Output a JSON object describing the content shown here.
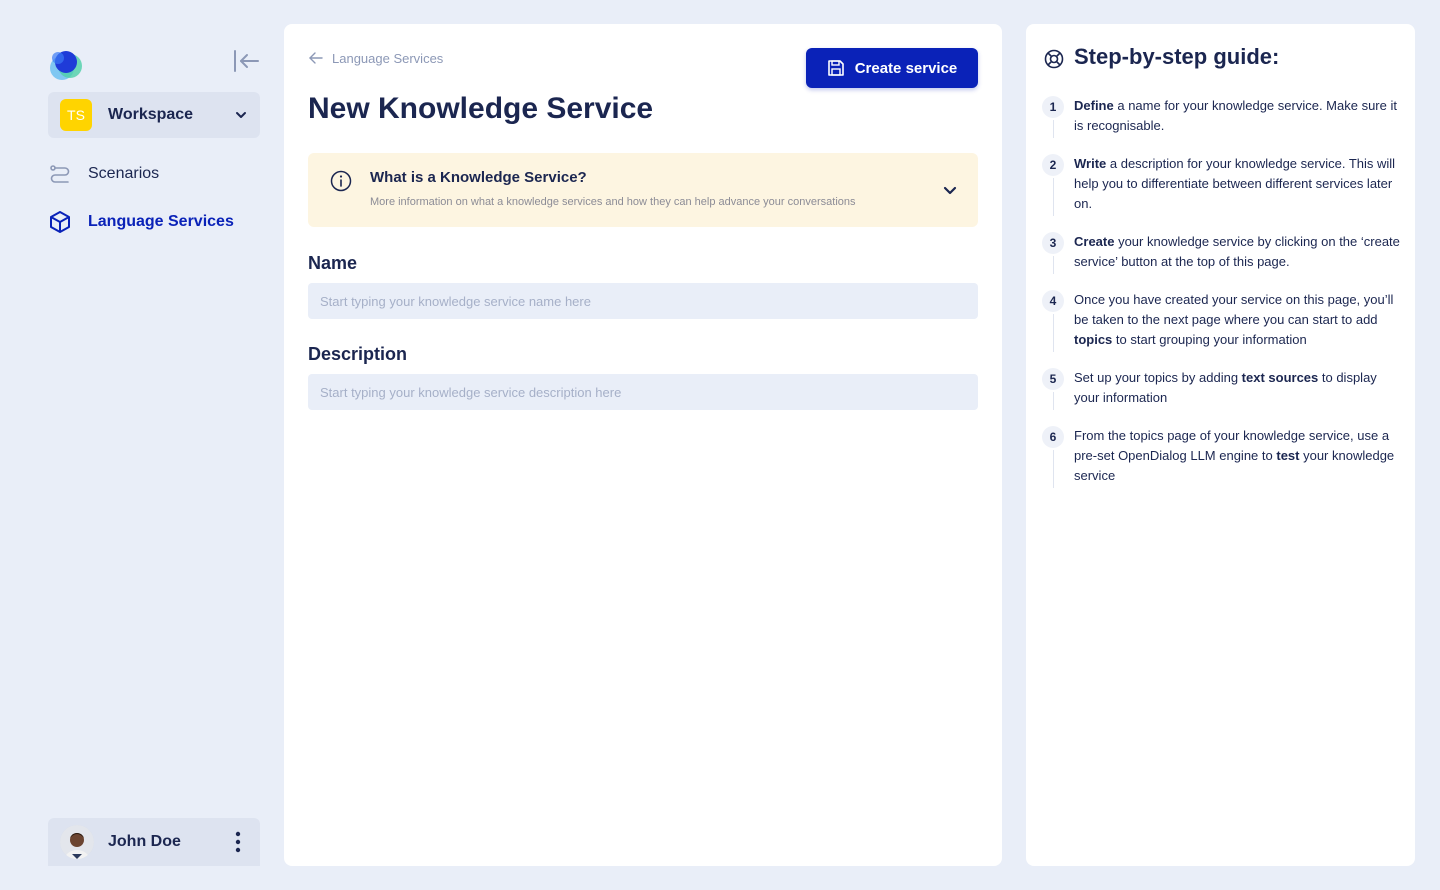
{
  "sidebar": {
    "workspace": {
      "initials": "TS",
      "label": "Workspace"
    },
    "nav": [
      {
        "label": "Scenarios"
      },
      {
        "label": "Language Services"
      }
    ],
    "user": {
      "name": "John Doe"
    }
  },
  "main": {
    "breadcrumb": "Language Services",
    "create_button": "Create service",
    "title": "New Knowledge Service",
    "info": {
      "title": "What is a Knowledge Service?",
      "subtitle": "More information on what a knowledge services and how they can help advance your conversations"
    },
    "name_label": "Name",
    "name_placeholder": "Start typing your knowledge service name here",
    "description_label": "Description",
    "description_placeholder": "Start typing your knowledge service description here"
  },
  "guide": {
    "title": "Step-by-step guide:",
    "steps": [
      {
        "num": "1",
        "parts": [
          {
            "b": "Define"
          },
          {
            "t": " a name for your knowledge service. Make sure it is recognisable."
          }
        ]
      },
      {
        "num": "2",
        "parts": [
          {
            "b": "Write"
          },
          {
            "t": " a description for your knowledge service. This will help you to differentiate between different services later on."
          }
        ]
      },
      {
        "num": "3",
        "parts": [
          {
            "b": "Create"
          },
          {
            "t": " your knowledge service by clicking on the ‘create service’ button at the top of this page."
          }
        ]
      },
      {
        "num": "4",
        "parts": [
          {
            "t": "Once you have created your service on this page, you’ll be taken to the next page where you can start to add "
          },
          {
            "b": "topics"
          },
          {
            "t": " to start grouping your information"
          }
        ]
      },
      {
        "num": "5",
        "parts": [
          {
            "t": "Set up your topics by adding "
          },
          {
            "b": "text sources"
          },
          {
            "t": " to display your information"
          }
        ]
      },
      {
        "num": "6",
        "parts": [
          {
            "t": "From the topics page of your knowledge service, use a pre-set OpenDialog LLM engine to "
          },
          {
            "b": "test"
          },
          {
            "t": " your knowledge service"
          }
        ]
      }
    ]
  },
  "colors": {
    "accent": "#0a22b8",
    "background": "#e9eef8",
    "info_box": "#fdf5e1",
    "workspace_badge": "#ffd400"
  },
  "icons": {
    "logo": "opendialog-logo-icon",
    "collapse": "collapse-left-icon",
    "chevron": "chevron-down-icon",
    "scenarios": "scenarios-path-icon",
    "language_services": "cube-icon",
    "kebab": "kebab-menu-icon",
    "back": "arrow-left-icon",
    "save": "save-icon",
    "info": "info-icon",
    "guide": "lifebuoy-icon"
  }
}
